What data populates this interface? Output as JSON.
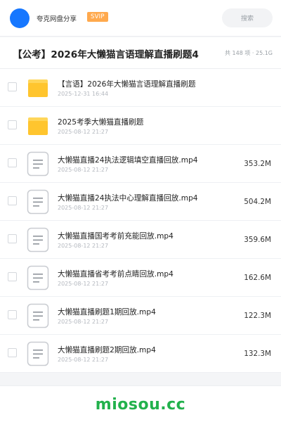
{
  "header": {
    "brand": "夸克网盘分享",
    "badge": "SVIP",
    "search_placeholder": "搜索",
    "avatar_color": "#1677ff",
    "badge_color": "#ffa94d"
  },
  "folder": {
    "title": "【公考】2026年大懒猫言语理解直播刷题4",
    "meta": "共 148 项 · 25.1G"
  },
  "files": [
    {
      "type": "folder",
      "icon": "folder-icon",
      "name": "【言语】2026年大懒猫言语理解直播刷题",
      "date": "2025-12-31 16:44",
      "size": ""
    },
    {
      "type": "folder",
      "icon": "folder-icon",
      "name": "2025考季大懒猫直播刷题",
      "date": "2025-08-12 21:27",
      "size": ""
    },
    {
      "type": "video",
      "icon": "document-icon",
      "name": "大懒猫直播24执法逻辑填空直播回放.mp4",
      "date": "2025-08-12 21:27",
      "size": "353.2M"
    },
    {
      "type": "video",
      "icon": "document-icon",
      "name": "大懒猫直播24执法中心理解直播回放.mp4",
      "date": "2025-08-12 21:27",
      "size": "504.2M"
    },
    {
      "type": "video",
      "icon": "document-icon",
      "name": "大懒猫直播国考考前充能回放.mp4",
      "date": "2025-08-12 21:27",
      "size": "359.6M"
    },
    {
      "type": "video",
      "icon": "document-icon",
      "name": "大懒猫直播省考考前点睛回放.mp4",
      "date": "2025-08-12 21:27",
      "size": "162.6M"
    },
    {
      "type": "video",
      "icon": "document-icon",
      "name": "大懒猫直播刷题1期回放.mp4",
      "date": "2025-08-12 21:27",
      "size": "122.3M"
    },
    {
      "type": "video",
      "icon": "document-icon",
      "name": "大懒猫直播刷题2期回放.mp4",
      "date": "2025-08-12 21:27",
      "size": "132.3M"
    }
  ],
  "footer": {
    "watermark": "miosou.cc",
    "watermark_color": "#22b14c"
  },
  "colors": {
    "folder": "#ffc52e",
    "folder_tab": "#ffd65a",
    "doc_border": "#c9ccd1",
    "doc_lines": "#8f949b"
  }
}
